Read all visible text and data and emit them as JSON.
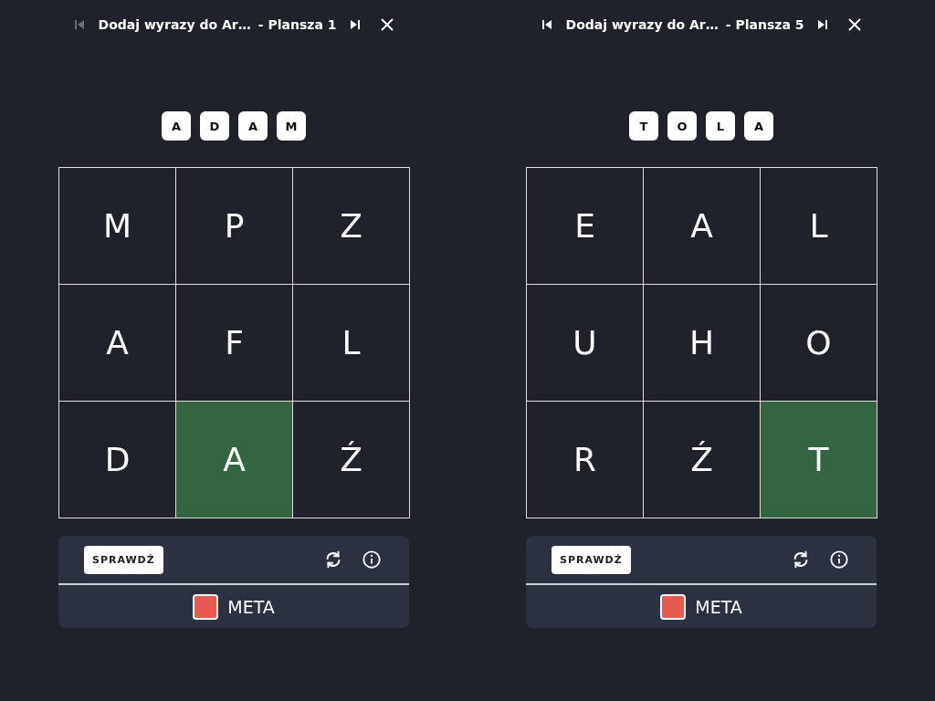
{
  "boards": [
    {
      "header": {
        "prev_disabled": true,
        "title": "Dodaj wyrazy do Ar…",
        "subtitle": "- Plansza 1"
      },
      "word": [
        "A",
        "D",
        "A",
        "M"
      ],
      "cells": [
        {
          "letter": "M",
          "selected": false
        },
        {
          "letter": "P",
          "selected": false
        },
        {
          "letter": "Z",
          "selected": false
        },
        {
          "letter": "A",
          "selected": false
        },
        {
          "letter": "F",
          "selected": false
        },
        {
          "letter": "L",
          "selected": false
        },
        {
          "letter": "D",
          "selected": false
        },
        {
          "letter": "A",
          "selected": true
        },
        {
          "letter": "Ź",
          "selected": false
        }
      ],
      "check_button": "SPRAWDŹ",
      "legend": {
        "color": "#e85a50",
        "label": "META"
      }
    },
    {
      "header": {
        "prev_disabled": false,
        "title": "Dodaj wyrazy do Ar…",
        "subtitle": "- Plansza 5"
      },
      "word": [
        "T",
        "O",
        "L",
        "A"
      ],
      "cells": [
        {
          "letter": "E",
          "selected": false
        },
        {
          "letter": "A",
          "selected": false
        },
        {
          "letter": "L",
          "selected": false
        },
        {
          "letter": "U",
          "selected": false
        },
        {
          "letter": "H",
          "selected": false
        },
        {
          "letter": "O",
          "selected": false
        },
        {
          "letter": "R",
          "selected": false
        },
        {
          "letter": "Ź",
          "selected": false
        },
        {
          "letter": "T",
          "selected": true
        }
      ],
      "check_button": "SPRAWDŹ",
      "legend": {
        "color": "#e85a50",
        "label": "META"
      }
    }
  ]
}
